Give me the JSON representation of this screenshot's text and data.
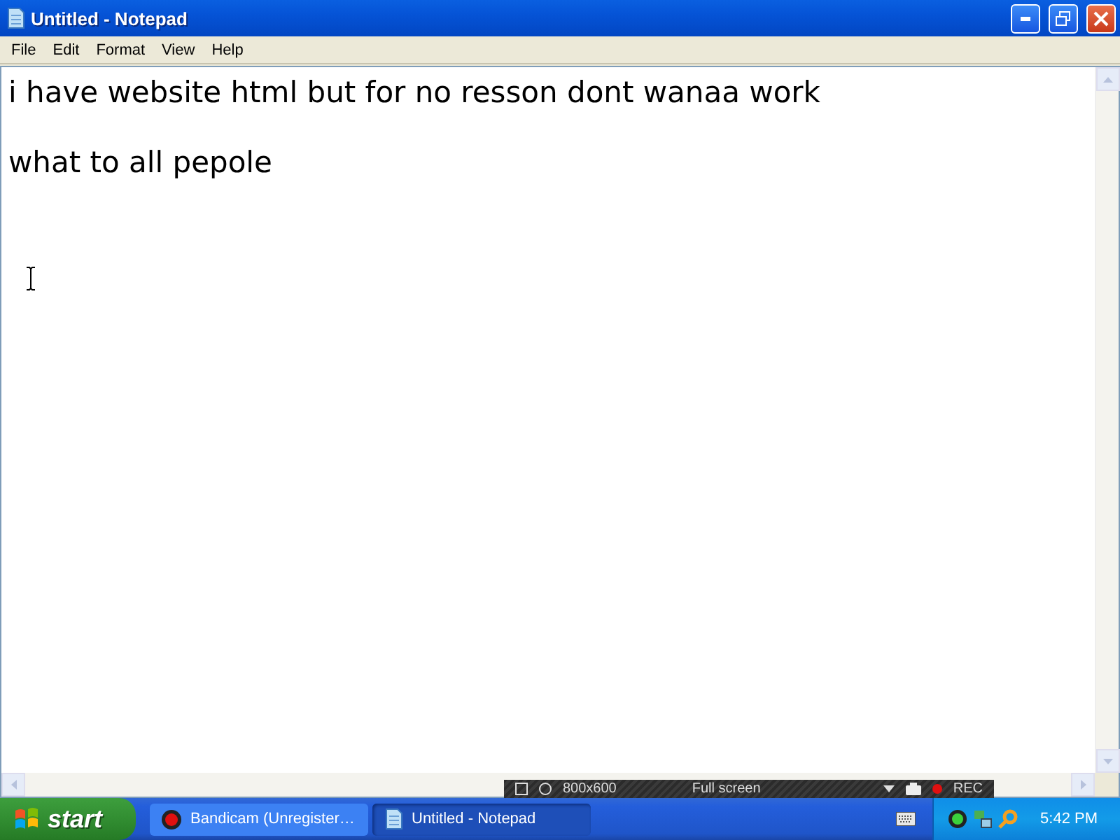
{
  "window": {
    "title": "Untitled - Notepad"
  },
  "menu": [
    "File",
    "Edit",
    "Format",
    "View",
    "Help"
  ],
  "document": {
    "paragraphs": [
      "i have website html but for no resson dont wanaa work",
      "what to all pepole"
    ]
  },
  "recorder_bar": {
    "resolution": "800x600",
    "mode": "Full screen",
    "record": "REC"
  },
  "taskbar": {
    "start": "start",
    "buttons": [
      {
        "label": "Bandicam (Unregister…",
        "kind": "recorder",
        "selected": false
      },
      {
        "label": "Untitled - Notepad",
        "kind": "notepad",
        "selected": true
      }
    ],
    "clock": "5:42 PM"
  }
}
